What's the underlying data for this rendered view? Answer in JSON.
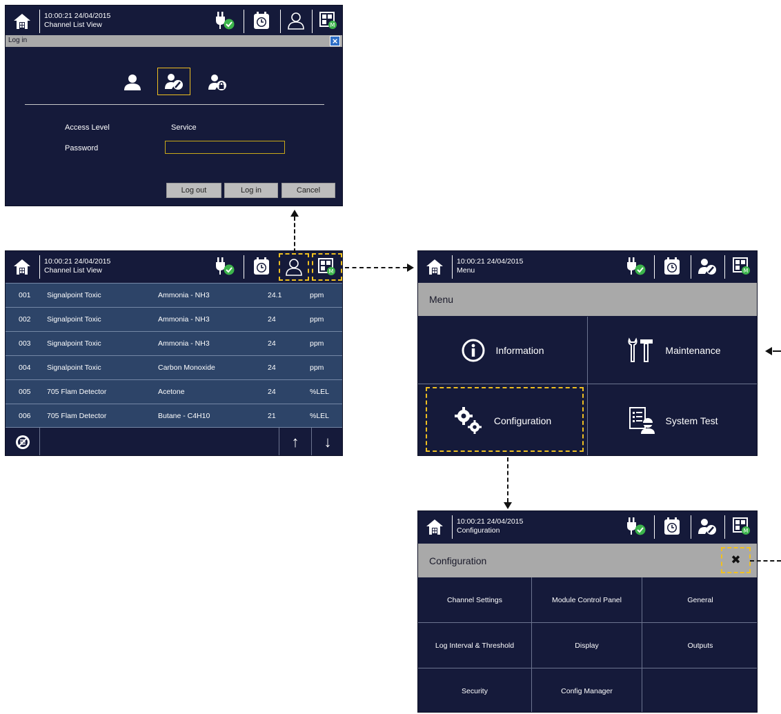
{
  "colors": {
    "screen_bg": "#151a3a",
    "row_bg": "#2d4468",
    "titlebar_bg": "#a9a9a9",
    "highlight": "#f0c020",
    "status_ok": "#3cb44b"
  },
  "header_icons": [
    "home-icon",
    "power-plug-ok-icon",
    "alarm-clock-icon",
    "user-icon",
    "user-service-icon",
    "module-status-icon"
  ],
  "login_screen": {
    "timestamp": "10:00:21 24/04/2015",
    "view": "Channel List View",
    "dialog_title": "Log in",
    "close": "×",
    "access_label": "Access Level",
    "access_value": "Service",
    "password_label": "Password",
    "password_value": "",
    "logout": "Log out",
    "login": "Log in",
    "cancel": "Cancel"
  },
  "channel_screen": {
    "timestamp": "10:00:21 24/04/2015",
    "view": "Channel List View",
    "rows": [
      {
        "id": "001",
        "device": "Signalpoint Toxic",
        "gas": "Ammonia - NH3",
        "value": "24.1",
        "unit": "ppm"
      },
      {
        "id": "002",
        "device": "Signalpoint Toxic",
        "gas": "Ammonia - NH3",
        "value": "24",
        "unit": "ppm"
      },
      {
        "id": "003",
        "device": "Signalpoint Toxic",
        "gas": "Ammonia - NH3",
        "value": "24",
        "unit": "ppm"
      },
      {
        "id": "004",
        "device": "Signalpoint Toxic",
        "gas": "Carbon Monoxide",
        "value": "24",
        "unit": "ppm"
      },
      {
        "id": "005",
        "device": "705 Flam Detector",
        "gas": "Acetone",
        "value": "24",
        "unit": "%LEL"
      },
      {
        "id": "006",
        "device": "705 Flam Detector",
        "gas": "Butane - C4H10",
        "value": "21",
        "unit": "%LEL"
      }
    ],
    "up": "↑",
    "down": "↓"
  },
  "menu_screen": {
    "timestamp": "10:00:21 24/04/2015",
    "view": "Menu",
    "title": "Menu",
    "items": [
      "Information",
      "Maintenance",
      "Configuration",
      "System Test"
    ]
  },
  "config_screen": {
    "timestamp": "10:00:21 24/04/2015",
    "view": "Configuration",
    "title": "Configuration",
    "close": "✖",
    "items": [
      "Channel Settings",
      "Module Control Panel",
      "General",
      "Log Interval & Threshold",
      "Display",
      "Outputs",
      "Security",
      "Config Manager",
      ""
    ]
  }
}
